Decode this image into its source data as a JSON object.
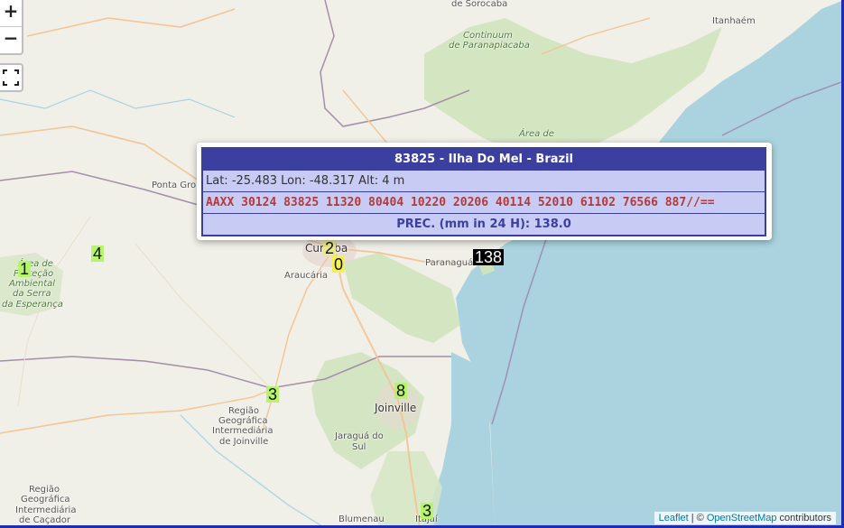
{
  "controls": {
    "zoom_in": "+",
    "zoom_out": "−",
    "fullscreen_icon": "fullscreen-icon"
  },
  "places": [
    {
      "name": "de Sorocaba",
      "kind": "small"
    },
    {
      "name": "Itanhaém",
      "kind": "small"
    },
    {
      "name": "Continuum",
      "kind": "green"
    },
    {
      "name": "de Paranapiacaba",
      "kind": "green"
    },
    {
      "name": "Área de",
      "kind": "green"
    },
    {
      "name": "Ponta Gro",
      "kind": "small"
    },
    {
      "name": "Curitiba",
      "kind": "city"
    },
    {
      "name": "Araucária",
      "kind": "small"
    },
    {
      "name": "Paranaguá",
      "kind": "small"
    },
    {
      "name": "Área de",
      "kind": "green"
    },
    {
      "name": "Proteção",
      "kind": "green"
    },
    {
      "name": "Ambiental",
      "kind": "green"
    },
    {
      "name": "da Serra",
      "kind": "green"
    },
    {
      "name": "da Esperança",
      "kind": "green"
    },
    {
      "name": "Região",
      "kind": "small"
    },
    {
      "name": "Geográfica",
      "kind": "small"
    },
    {
      "name": "Intermediária",
      "kind": "small"
    },
    {
      "name": "de Joinville",
      "kind": "small"
    },
    {
      "name": "Joinville",
      "kind": "city"
    },
    {
      "name": "Jaraguá do",
      "kind": "small"
    },
    {
      "name": "Sul",
      "kind": "small"
    },
    {
      "name": "Região",
      "kind": "small"
    },
    {
      "name": "Geográfica",
      "kind": "small"
    },
    {
      "name": "Intermediária",
      "kind": "small"
    },
    {
      "name": "de Caçador",
      "kind": "small"
    },
    {
      "name": "Blumenau",
      "kind": "small"
    },
    {
      "name": "Itajaí",
      "kind": "small"
    }
  ],
  "markers": [
    {
      "value": "4",
      "color": "#b6f56b"
    },
    {
      "value": "1",
      "color": "#b6f56b"
    },
    {
      "value": "2",
      "color": "#ece98a"
    },
    {
      "value": "0",
      "color": "#f3f14d"
    },
    {
      "value": "138",
      "color": "#000000",
      "text_color": "#ffffff"
    },
    {
      "value": "3",
      "color": "#b6f56b"
    },
    {
      "value": "8",
      "color": "#b6f56b"
    },
    {
      "value": "3",
      "color": "#b6f56b"
    }
  ],
  "popup": {
    "title": "83825 - Ilha Do Mel - Brazil",
    "coords": "Lat: -25.483 Lon: -48.317 Alt: 4 m",
    "synop": "AAXX 30124 83825 11320 80404 10220 20206 40114 52010 61102 76566 887//==",
    "prec": "PREC. (mm in 24 H): 138.0"
  },
  "attribution": {
    "leaflet": "Leaflet",
    "sep": " | © ",
    "osm": "OpenStreetMap",
    "contributors": " contributors"
  }
}
